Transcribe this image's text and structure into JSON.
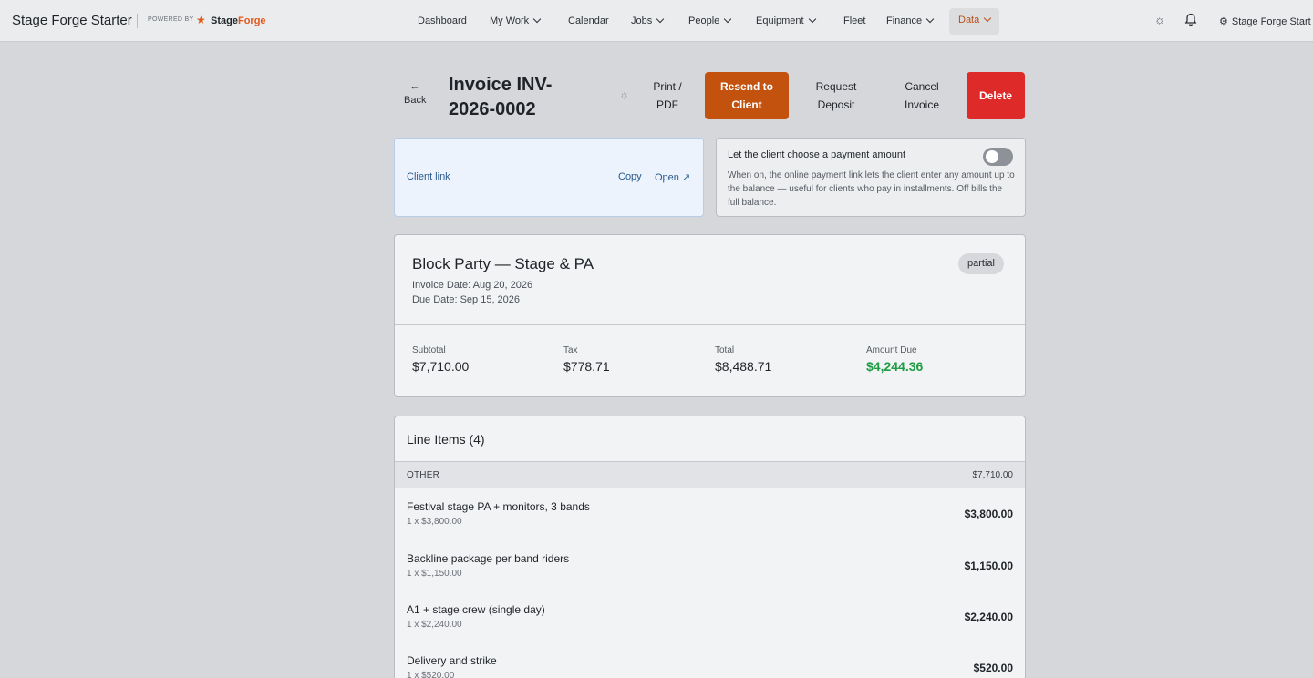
{
  "app": {
    "title": "Stage Forge Starter",
    "powered_by": "POWERED BY",
    "brand_part1": "Stage",
    "brand_part2": "Forge",
    "accent_color": "#c2520e"
  },
  "nav": {
    "items": [
      {
        "label": "Dashboard",
        "has_menu": false
      },
      {
        "label": "My Work",
        "has_menu": true
      },
      {
        "label": "Calendar",
        "has_menu": false
      },
      {
        "label": "Jobs",
        "has_menu": true
      },
      {
        "label": "People",
        "has_menu": true
      },
      {
        "label": "Equipment",
        "has_menu": true
      },
      {
        "label": "Fleet",
        "has_menu": false
      },
      {
        "label": "Finance",
        "has_menu": true
      },
      {
        "label": "Data",
        "has_menu": true,
        "active": true
      }
    ],
    "user_label": "Stage Forge Start"
  },
  "header": {
    "back_label": "Back",
    "title": "Invoice INV-2026-0002",
    "actions": {
      "print": "Print / PDF",
      "resend": "Resend to Client",
      "deposit": "Request Deposit",
      "cancel": "Cancel Invoice",
      "delete": "Delete"
    }
  },
  "client_link": {
    "label": "Client link",
    "copy": "Copy",
    "open": "Open ↗"
  },
  "payment_amount": {
    "title": "Let the client choose a payment amount",
    "enabled": false,
    "description": "When on, the online payment link lets the client enter any amount up to the balance — useful for clients who pay in installments. Off bills the full balance."
  },
  "summary": {
    "title": "Block Party — Stage & PA",
    "invoice_date": "Invoice Date: Aug 20, 2026",
    "due_date": "Due Date: Sep 15, 2026",
    "status": "partial",
    "stats": [
      {
        "label": "Subtotal",
        "value": "$7,710.00"
      },
      {
        "label": "Tax",
        "value": "$778.71"
      },
      {
        "label": "Total",
        "value": "$8,488.71"
      },
      {
        "label": "Amount Due",
        "value": "$4,244.36",
        "highlight_color": "#1f9d44"
      }
    ]
  },
  "line_items": {
    "title": "Line Items (4)",
    "group": {
      "name": "OTHER",
      "total": "$7,710.00"
    },
    "rows": [
      {
        "name": "Festival stage PA + monitors, 3 bands",
        "qty": "1 x $3,800.00",
        "amount": "$3,800.00"
      },
      {
        "name": "Backline package per band riders",
        "qty": "1 x $1,150.00",
        "amount": "$1,150.00"
      },
      {
        "name": "A1 + stage crew (single day)",
        "qty": "1 x $2,240.00",
        "amount": "$2,240.00"
      },
      {
        "name": "Delivery and strike",
        "qty": "1 x $520.00",
        "amount": "$520.00"
      }
    ]
  }
}
